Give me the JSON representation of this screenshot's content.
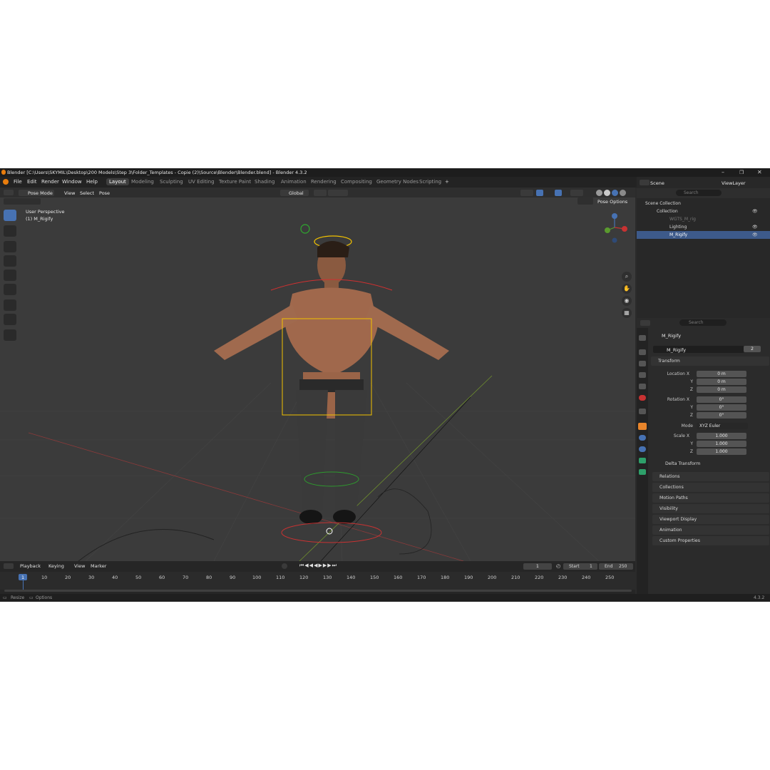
{
  "window": {
    "title": "Blender [C:\\Users\\SKYMIL\\Desktop\\200 Models\\Step 3\\Folder_Templates - Copie (2)\\Source\\Blender\\Blender.blend] - Blender 4.3.2"
  },
  "menu": [
    "File",
    "Edit",
    "Render",
    "Window",
    "Help"
  ],
  "workspaces": [
    "Layout",
    "Modeling",
    "Sculpting",
    "UV Editing",
    "Texture Paint",
    "Shading",
    "Animation",
    "Rendering",
    "Compositing",
    "Geometry Nodes",
    "Scripting"
  ],
  "active_workspace": "Layout",
  "scene": {
    "name": "Scene",
    "view_layer": "ViewLayer"
  },
  "viewport_header": {
    "mode": "Pose Mode",
    "menus": [
      "View",
      "Select",
      "Pose"
    ],
    "orientation": "Global",
    "pose_options": "Pose Options"
  },
  "viewport": {
    "perspective": "User Perspective",
    "object": "(1) M_Rigify"
  },
  "outliner": {
    "search_placeholder": "Search",
    "items": [
      {
        "label": "Scene Collection"
      },
      {
        "label": "Collection"
      },
      {
        "label": "WGTS_M_rig"
      },
      {
        "label": "Lighting"
      },
      {
        "label": "M_Rigify"
      }
    ]
  },
  "properties": {
    "search_placeholder": "Search",
    "object_name": "M_Rigify",
    "data_name": "M_Rigify",
    "users": "2",
    "transform": {
      "title": "Transform",
      "location_label": "Location X",
      "location": [
        "0 m",
        "0 m",
        "0 m"
      ],
      "rotation_label": "Rotation X",
      "rotation": [
        "0°",
        "0°",
        "0°"
      ],
      "mode_label": "Mode",
      "mode": "XYZ Euler",
      "scale_label": "Scale X",
      "scale": [
        "1.000",
        "1.000",
        "1.000"
      ],
      "axis_y": "Y",
      "axis_z": "Z",
      "delta": "Delta Transform"
    },
    "panels": [
      "Relations",
      "Collections",
      "Motion Paths",
      "Visibility",
      "Viewport Display",
      "Animation",
      "Custom Properties"
    ]
  },
  "timeline": {
    "menus": [
      "Playback",
      "Keying",
      "View",
      "Marker"
    ],
    "current_frame": "1",
    "start_label": "Start",
    "start": "1",
    "end_label": "End",
    "end": "250",
    "ruler": [
      "1",
      "10",
      "20",
      "30",
      "40",
      "50",
      "60",
      "70",
      "80",
      "90",
      "100",
      "110",
      "120",
      "130",
      "140",
      "150",
      "160",
      "170",
      "180",
      "190",
      "200",
      "210",
      "220",
      "230",
      "240",
      "250"
    ]
  },
  "statusbar": {
    "left": [
      "Resize",
      "Options"
    ],
    "version": "4.3.2"
  },
  "colors": {
    "accent": "#4772b3",
    "panel": "#2b2b2b",
    "viewport": "#3b3b3b"
  }
}
